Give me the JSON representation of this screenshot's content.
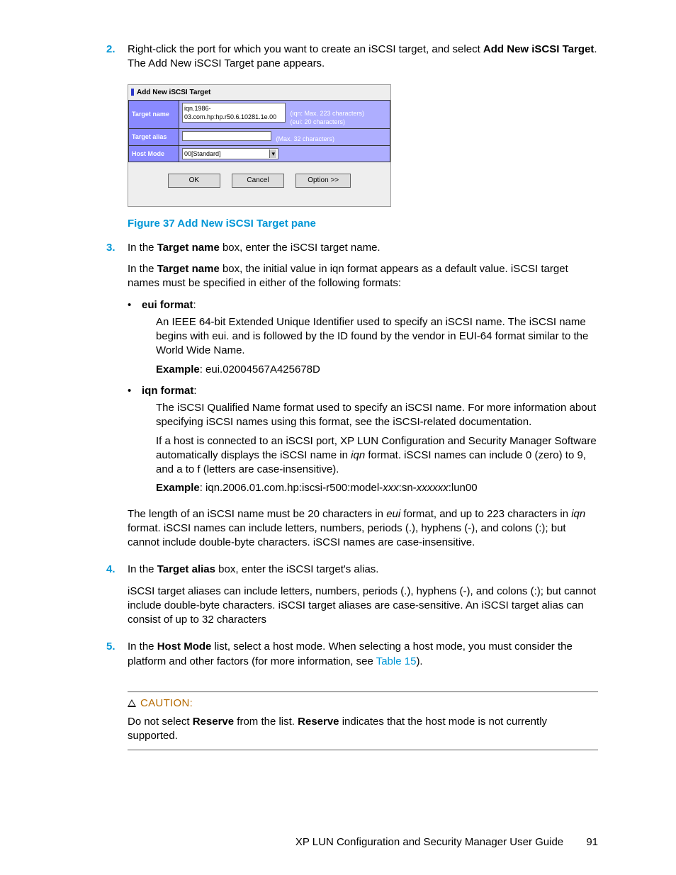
{
  "steps": {
    "s2": {
      "num": "2.",
      "text_a": "Right-click the port for which you want to create an iSCSI target, and select ",
      "bold": "Add New iSCSI Target",
      "text_b": ". The Add New iSCSI Target pane appears."
    },
    "s3": {
      "num": "3.",
      "line1_a": "In the ",
      "line1_bold": "Target name",
      "line1_b": " box, enter the iSCSI target name.",
      "line2_a": "In the ",
      "line2_bold": "Target name",
      "line2_b": " box, the initial value in iqn format appears as a default value. iSCSI target names must be specified in either of the following formats:"
    },
    "s4": {
      "num": "4.",
      "line1_a": "In the ",
      "line1_bold": "Target alias",
      "line1_b": " box, enter the iSCSI target's alias.",
      "line2": "iSCSI target aliases can include letters, numbers, periods (.), hyphens (-), and colons (:); but cannot include double-byte characters. iSCSI target aliases are case-sensitive. An iSCSI target alias can consist of up to 32 characters"
    },
    "s5": {
      "num": "5.",
      "text_a": "In the ",
      "bold": "Host Mode",
      "text_b": " list, select a host mode. When selecting a host mode, you must consider the platform and other factors (for more information, see ",
      "link": "Table 15",
      "text_c": ")."
    }
  },
  "dialog": {
    "title": "Add New iSCSI Target",
    "row1_label": "Target name",
    "row1_value": "iqn.1986-03.com.hp:hp.r50.6.10281.1e.00",
    "row1_hint1": "(iqn: Max. 223 characters)",
    "row1_hint2": "(eui: 20 characters)",
    "row2_label": "Target alias",
    "row2_hint": "(Max. 32 characters)",
    "row3_label": "Host Mode",
    "row3_value": "00[Standard]",
    "btn_ok": "OK",
    "btn_cancel": "Cancel",
    "btn_option": "Option >>"
  },
  "figure_caption": "Figure 37 Add New iSCSI Target pane",
  "formats": {
    "eui": {
      "title": "eui format",
      "colon": ":",
      "p1": "An IEEE 64-bit Extended Unique Identifier used to specify an iSCSI name. The iSCSI name begins with eui. and is followed by the ID found by the vendor in EUI-64 format similar to the World Wide Name.",
      "ex_label": "Example",
      "ex_val": ": eui.02004567A425678D"
    },
    "iqn": {
      "title": "iqn format",
      "colon": ":",
      "p1": "The iSCSI Qualified Name format used to specify an iSCSI name. For more information about specifying iSCSI names using this format, see the iSCSI-related documentation.",
      "p2_a": "If a host is connected to an iSCSI port, XP LUN Configuration and Security Manager Software automatically displays the iSCSI name in ",
      "p2_i": "iqn",
      "p2_b": " format. iSCSI names can include 0 (zero) to 9, and a to f (letters are case-insensitive).",
      "ex_label": "Example",
      "ex_val_a": ": iqn.2006.01.com.hp:iscsi-r500:model-",
      "ex_i1": "xxx",
      "ex_val_b": ":sn-",
      "ex_i2": "xxxxxx",
      "ex_val_c": ":lun00"
    }
  },
  "length_note": {
    "a": "The length of an iSCSI name must be 20 characters in ",
    "i1": "eui",
    "b": " format, and up to 223 characters in ",
    "i2": "iqn",
    "c": " format. iSCSI names can include letters, numbers, periods (.), hyphens (-), and colons (:); but cannot include double-byte characters. iSCSI names are case-insensitive."
  },
  "caution": {
    "label": "CAUTION:",
    "text_a": "Do not select ",
    "bold1": "Reserve",
    "text_b": " from the list. ",
    "bold2": "Reserve",
    "text_c": " indicates that the host mode is not currently supported."
  },
  "footer": {
    "title": "XP LUN Configuration and Security Manager User Guide",
    "page": "91"
  }
}
